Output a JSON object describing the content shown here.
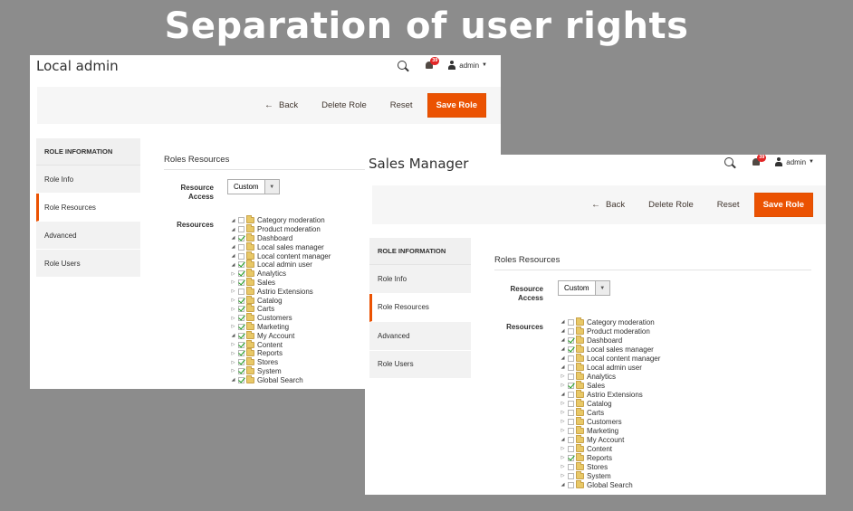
{
  "headline": "Separation of user rights",
  "panels": [
    {
      "title": "Local admin",
      "notification_count": "39",
      "user_label": "admin",
      "toolbar": {
        "back": "Back",
        "delete": "Delete Role",
        "reset": "Reset",
        "save": "Save Role"
      },
      "sidebar": {
        "heading": "ROLE INFORMATION",
        "items": [
          "Role Info",
          "Role Resources",
          "Advanced",
          "Role Users"
        ],
        "active_index": 1
      },
      "section_title": "Roles Resources",
      "resource_access_label": "Resource Access",
      "resource_access_value": "Custom",
      "resources_label": "Resources",
      "tree": [
        {
          "label": "Category moderation",
          "checked": false,
          "expanded": true
        },
        {
          "label": "Product moderation",
          "checked": false,
          "expanded": true
        },
        {
          "label": "Dashboard",
          "checked": true,
          "expanded": true
        },
        {
          "label": "Local sales manager",
          "checked": false,
          "expanded": true
        },
        {
          "label": "Local content manager",
          "checked": false,
          "expanded": true
        },
        {
          "label": "Local admin user",
          "checked": true,
          "expanded": true
        },
        {
          "label": "Analytics",
          "checked": true,
          "expanded": false
        },
        {
          "label": "Sales",
          "checked": true,
          "expanded": false
        },
        {
          "label": "Astrio Extensions",
          "checked": false,
          "expanded": false
        },
        {
          "label": "Catalog",
          "checked": true,
          "expanded": false
        },
        {
          "label": "Carts",
          "checked": true,
          "expanded": false
        },
        {
          "label": "Customers",
          "checked": true,
          "expanded": false
        },
        {
          "label": "Marketing",
          "checked": true,
          "expanded": false
        },
        {
          "label": "My Account",
          "checked": true,
          "expanded": true
        },
        {
          "label": "Content",
          "checked": true,
          "expanded": false
        },
        {
          "label": "Reports",
          "checked": true,
          "expanded": false
        },
        {
          "label": "Stores",
          "checked": true,
          "expanded": false
        },
        {
          "label": "System",
          "checked": true,
          "expanded": false
        },
        {
          "label": "Global Search",
          "checked": true,
          "expanded": true
        }
      ]
    },
    {
      "title": "Sales Manager",
      "notification_count": "39",
      "user_label": "admin",
      "toolbar": {
        "back": "Back",
        "delete": "Delete Role",
        "reset": "Reset",
        "save": "Save Role"
      },
      "sidebar": {
        "heading": "ROLE INFORMATION",
        "items": [
          "Role Info",
          "Role Resources",
          "Advanced",
          "Role Users"
        ],
        "active_index": 1
      },
      "section_title": "Roles Resources",
      "resource_access_label": "Resource Access",
      "resource_access_value": "Custom",
      "resources_label": "Resources",
      "tree": [
        {
          "label": "Category moderation",
          "checked": false,
          "expanded": true
        },
        {
          "label": "Product moderation",
          "checked": false,
          "expanded": true
        },
        {
          "label": "Dashboard",
          "checked": true,
          "expanded": true
        },
        {
          "label": "Local sales manager",
          "checked": true,
          "expanded": true
        },
        {
          "label": "Local content manager",
          "checked": false,
          "expanded": true
        },
        {
          "label": "Local admin user",
          "checked": false,
          "expanded": true
        },
        {
          "label": "Analytics",
          "checked": false,
          "expanded": false
        },
        {
          "label": "Sales",
          "checked": true,
          "expanded": false
        },
        {
          "label": "Astrio Extensions",
          "checked": false,
          "expanded": true
        },
        {
          "label": "Catalog",
          "checked": false,
          "expanded": false
        },
        {
          "label": "Carts",
          "checked": false,
          "expanded": false
        },
        {
          "label": "Customers",
          "checked": false,
          "expanded": false
        },
        {
          "label": "Marketing",
          "checked": false,
          "expanded": false
        },
        {
          "label": "My Account",
          "checked": false,
          "expanded": true
        },
        {
          "label": "Content",
          "checked": false,
          "expanded": false
        },
        {
          "label": "Reports",
          "checked": true,
          "expanded": false
        },
        {
          "label": "Stores",
          "checked": false,
          "expanded": false
        },
        {
          "label": "System",
          "checked": false,
          "expanded": false
        },
        {
          "label": "Global Search",
          "checked": false,
          "expanded": true
        }
      ]
    }
  ]
}
